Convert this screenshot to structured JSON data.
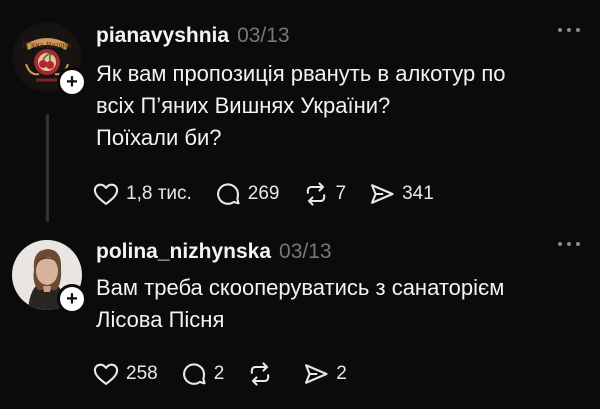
{
  "posts": [
    {
      "username": "pianavyshnia",
      "date": "03/13",
      "lines": [
        "Як вам пропозиція рвануть в алкотур по",
        "всіх П’яних Вишнях України?",
        "Поїхали би?"
      ],
      "counts": {
        "likes": "1,8 тис.",
        "comments": "269",
        "reposts": "7",
        "shares": "341"
      },
      "avatar_text": "Пʼяна Вишня"
    },
    {
      "username": "polina_nizhynska",
      "date": "03/13",
      "lines": [
        "Вам треба скооперуватись з санаторієм",
        "Лісова Пісня"
      ],
      "counts": {
        "likes": "258",
        "comments": "2",
        "reposts": "",
        "shares": "2"
      }
    }
  ],
  "icons": [
    "heart-icon",
    "comment-icon",
    "repost-icon",
    "share-icon",
    "more-icon",
    "plus-icon"
  ],
  "colors": {
    "background": "#0b0b0b",
    "text": "#f3f3f3",
    "muted": "#777777",
    "badge": "#ffffff"
  }
}
